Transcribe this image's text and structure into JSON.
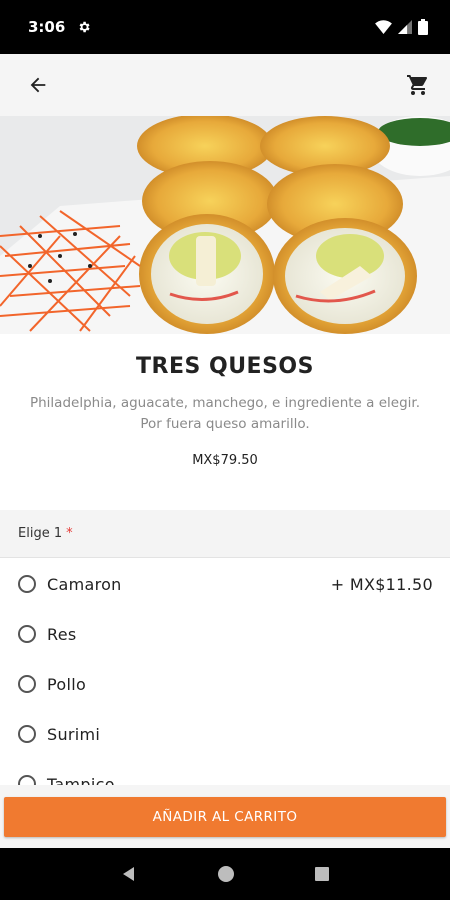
{
  "status_bar": {
    "time": "3:06"
  },
  "app_bar": {
    "back_icon": "arrow-back-icon",
    "cart_icon": "shopping-cart-icon"
  },
  "product": {
    "image": "sushi-roll-photo",
    "title": "TRES QUESOS",
    "description": "Philadelphia, aguacate, manchego, e ingrediente a elegir. Por fuera queso amarillo.",
    "price": "MX$79.50"
  },
  "options": {
    "header": "Elige 1",
    "required_marker": "*",
    "items": [
      {
        "label": "Camaron",
        "price": "+ MX$11.50"
      },
      {
        "label": "Res",
        "price": ""
      },
      {
        "label": "Pollo",
        "price": ""
      },
      {
        "label": "Surimi",
        "price": ""
      },
      {
        "label": "Tampico",
        "price": ""
      }
    ]
  },
  "cart_button": {
    "label": "AÑADIR AL CARRITO",
    "color": "#f07a30"
  }
}
